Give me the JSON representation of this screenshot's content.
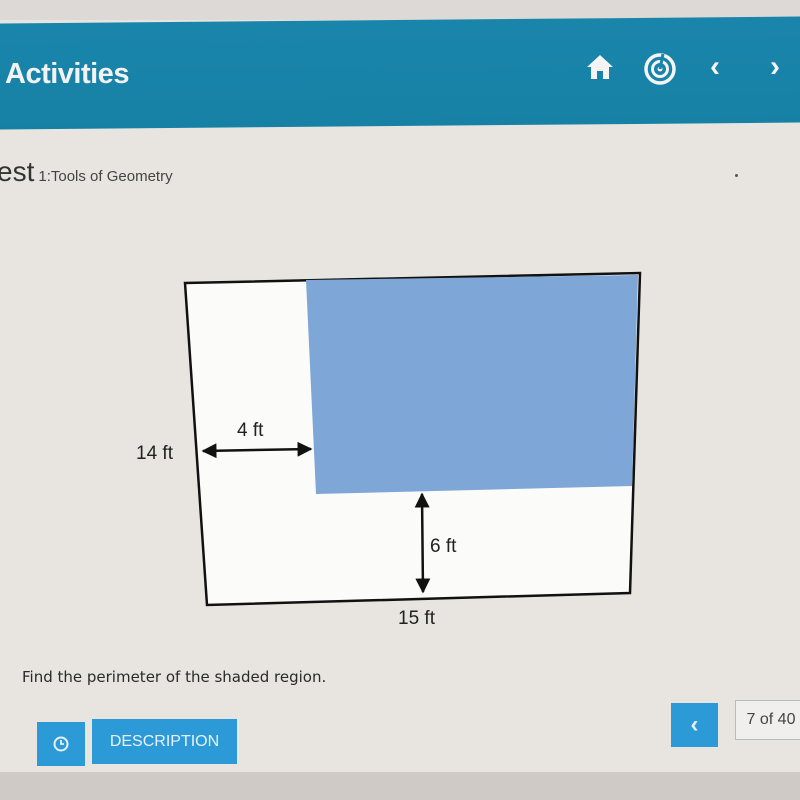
{
  "header": {
    "title": "Activities",
    "icons": [
      "home-icon",
      "radar-icon",
      "chevron-left-icon",
      "chevron-right-icon"
    ],
    "color": "#1a85ab"
  },
  "page": {
    "title_fragment": "est",
    "subtitle": "1:Tools of Geometry"
  },
  "figure": {
    "labels": {
      "height": "14 ft",
      "left_gap": "4 ft",
      "bottom_gap": "6 ft",
      "width": "15 ft"
    },
    "shade_color": "#7ea6d6"
  },
  "question": "Find the perimeter of the shaded region.",
  "footer": {
    "timer_icon": "clock-icon",
    "description_label": "DESCRIPTION",
    "prev_icon": "chevron-left-icon",
    "pager": "7 of 40",
    "button_color": "#2d9ad8"
  }
}
